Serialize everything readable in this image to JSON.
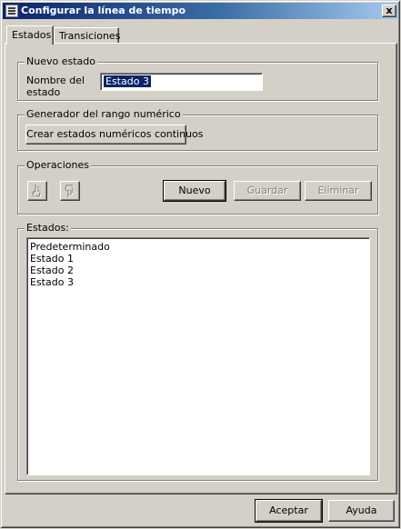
{
  "window": {
    "title": "Configurar la línea de tiempo",
    "close_label": "x"
  },
  "tabs": [
    {
      "label": "Estados",
      "selected": true
    },
    {
      "label": "Transiciones",
      "selected": false
    }
  ],
  "nuevo_estado": {
    "group_label": "Nuevo estado",
    "name_label_line1": "Nombre del",
    "name_label_line2": "estado",
    "name_value": "Estado 3"
  },
  "generador": {
    "group_label": "Generador del rango numérico",
    "button_label": "Crear estados numéricos continuos"
  },
  "operaciones": {
    "group_label": "Operaciones",
    "icon_buttons": [
      {
        "icon": "hand-up-icon",
        "enabled": false
      },
      {
        "icon": "hand-down-icon",
        "enabled": false
      }
    ],
    "nuevo_label": "Nuevo",
    "guardar_label": "Guardar",
    "guardar_enabled": false,
    "eliminar_label": "Eliminar",
    "eliminar_enabled": false
  },
  "estados": {
    "group_label": "Estados:",
    "items": [
      "Predeterminado",
      "Estado 1",
      "Estado 2",
      "Estado 3"
    ]
  },
  "footer": {
    "accept_label": "Aceptar",
    "help_label": "Ayuda"
  },
  "colors": {
    "face": "#d4d0c8",
    "titlebar_start": "#0a246a",
    "titlebar_end": "#a6caf0",
    "selection": "#0a246a",
    "disabled_text": "#808080"
  }
}
